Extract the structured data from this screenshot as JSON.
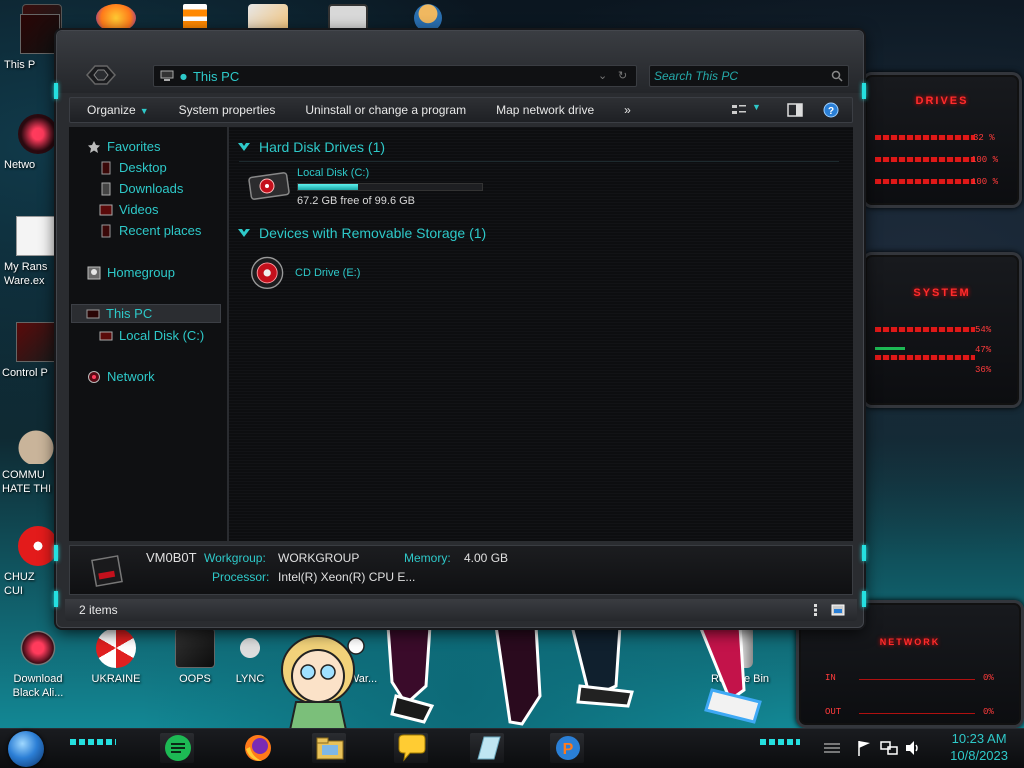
{
  "desktop": {
    "icons": [
      {
        "label": "This P",
        "icon": "this-pc-icon"
      },
      {
        "label": "Netwo",
        "icon": "network-icon"
      },
      {
        "label": "My Rans\nWare.ex",
        "icon": "document-icon"
      },
      {
        "label": "Control P",
        "icon": "control-panel-icon"
      },
      {
        "label": "COMMU\nHATE THI",
        "icon": "money-bag-icon"
      },
      {
        "label": "CHUZ\nCUI",
        "icon": "cartoon-icon"
      },
      {
        "label": "Download\nBlack Ali...",
        "icon": "alienware-icon"
      },
      {
        "label": "UKRAINE",
        "icon": "radiation-icon"
      },
      {
        "label": "OOPS",
        "icon": "alienware-head-icon"
      },
      {
        "label": "LYNC",
        "icon": "lync-icon"
      },
      {
        "label": "War...",
        "icon": "war-icon"
      },
      {
        "label": "Recycle Bin",
        "icon": "recycle-bin-icon"
      }
    ]
  },
  "gadgets": {
    "drives": {
      "title": "DRIVES",
      "values": [
        "32 %",
        "100 %",
        "100 %"
      ]
    },
    "system": {
      "title": "SYSTEM",
      "values": [
        "54%",
        "47%",
        "36%"
      ]
    },
    "network": {
      "title": "NETWORK",
      "in_label": "IN",
      "out_label": "OUT",
      "in_value": "0%",
      "out_value": "0%"
    }
  },
  "window": {
    "address": "This PC",
    "search_placeholder": "Search This PC",
    "toolbar": {
      "organize": "Organize",
      "system_properties": "System properties",
      "uninstall": "Uninstall or change a program",
      "map_drive": "Map network drive",
      "more": "»"
    },
    "nav": {
      "favorites": "Favorites",
      "desktop": "Desktop",
      "downloads": "Downloads",
      "videos": "Videos",
      "recent": "Recent places",
      "homegroup": "Homegroup",
      "this_pc": "This PC",
      "local_disk": "Local Disk (C:)",
      "network": "Network"
    },
    "content": {
      "hdd_header": "Hard Disk Drives (1)",
      "removable_header": "Devices with Removable Storage (1)",
      "local_disk": {
        "name": "Local Disk (C:)",
        "free": "67.2 GB free of 99.6 GB",
        "used_fraction": 0.325
      },
      "cd_drive": {
        "name": "CD Drive (E:)"
      }
    },
    "details": {
      "computer_name": "VM0B0T",
      "workgroup_label": "Workgroup:",
      "workgroup_value": "WORKGROUP",
      "memory_label": "Memory:",
      "memory_value": "4.00 GB",
      "processor_label": "Processor:",
      "processor_value": "Intel(R) Xeon(R) CPU E..."
    },
    "status": "2 items"
  },
  "taskbar": {
    "clock_time": "10:23 AM",
    "clock_date": "10/8/2023"
  },
  "colors": {
    "accent": "#2ec9c9",
    "alien_red": "#e01818"
  }
}
